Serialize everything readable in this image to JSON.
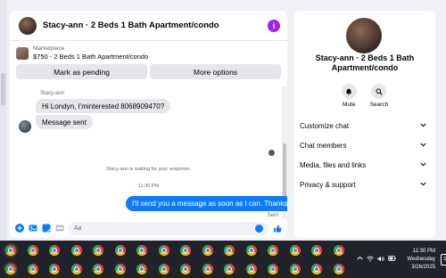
{
  "chat": {
    "title": "Stacy-ann · 2 Beds 1 Bath Apartment/condo",
    "marketplace_label": "Marketplace",
    "listing": "$750 - 2 Beds 1 Bath Apartment/condo",
    "mark_pending_label": "Mark as pending",
    "more_options_label": "More options",
    "sender_name": "Stacy-ann",
    "messages": [
      {
        "text": "Hi Londyn, I'minterested 8068909470?",
        "direction": "in"
      },
      {
        "text": "Message sent",
        "direction": "in"
      },
      {
        "text": "I'll send you a message as soon as I can. Thanks",
        "direction": "out"
      }
    ],
    "waiting_notice": "Stacy-ann is waiting for your response.",
    "timestamp": "11:30 PM",
    "sent_status": "Sent",
    "composer_placeholder": "Aa"
  },
  "panel": {
    "title": "Stacy-ann · 2 Beds 1 Bath Apartment/condo",
    "mute_label": "Mute",
    "search_label": "Search",
    "rows": [
      {
        "label": "Customize chat"
      },
      {
        "label": "Chat members"
      },
      {
        "label": "Media, files and links"
      },
      {
        "label": "Privacy & support"
      }
    ]
  },
  "taskbar": {
    "time": "11:30 PM",
    "day": "Wednesday",
    "date": "3/26/2025",
    "notification_count": "14"
  },
  "colors": {
    "messenger_blue": "#0a7cff",
    "info_purple": "#a020f0",
    "taskbar_bg": "#20232a"
  }
}
